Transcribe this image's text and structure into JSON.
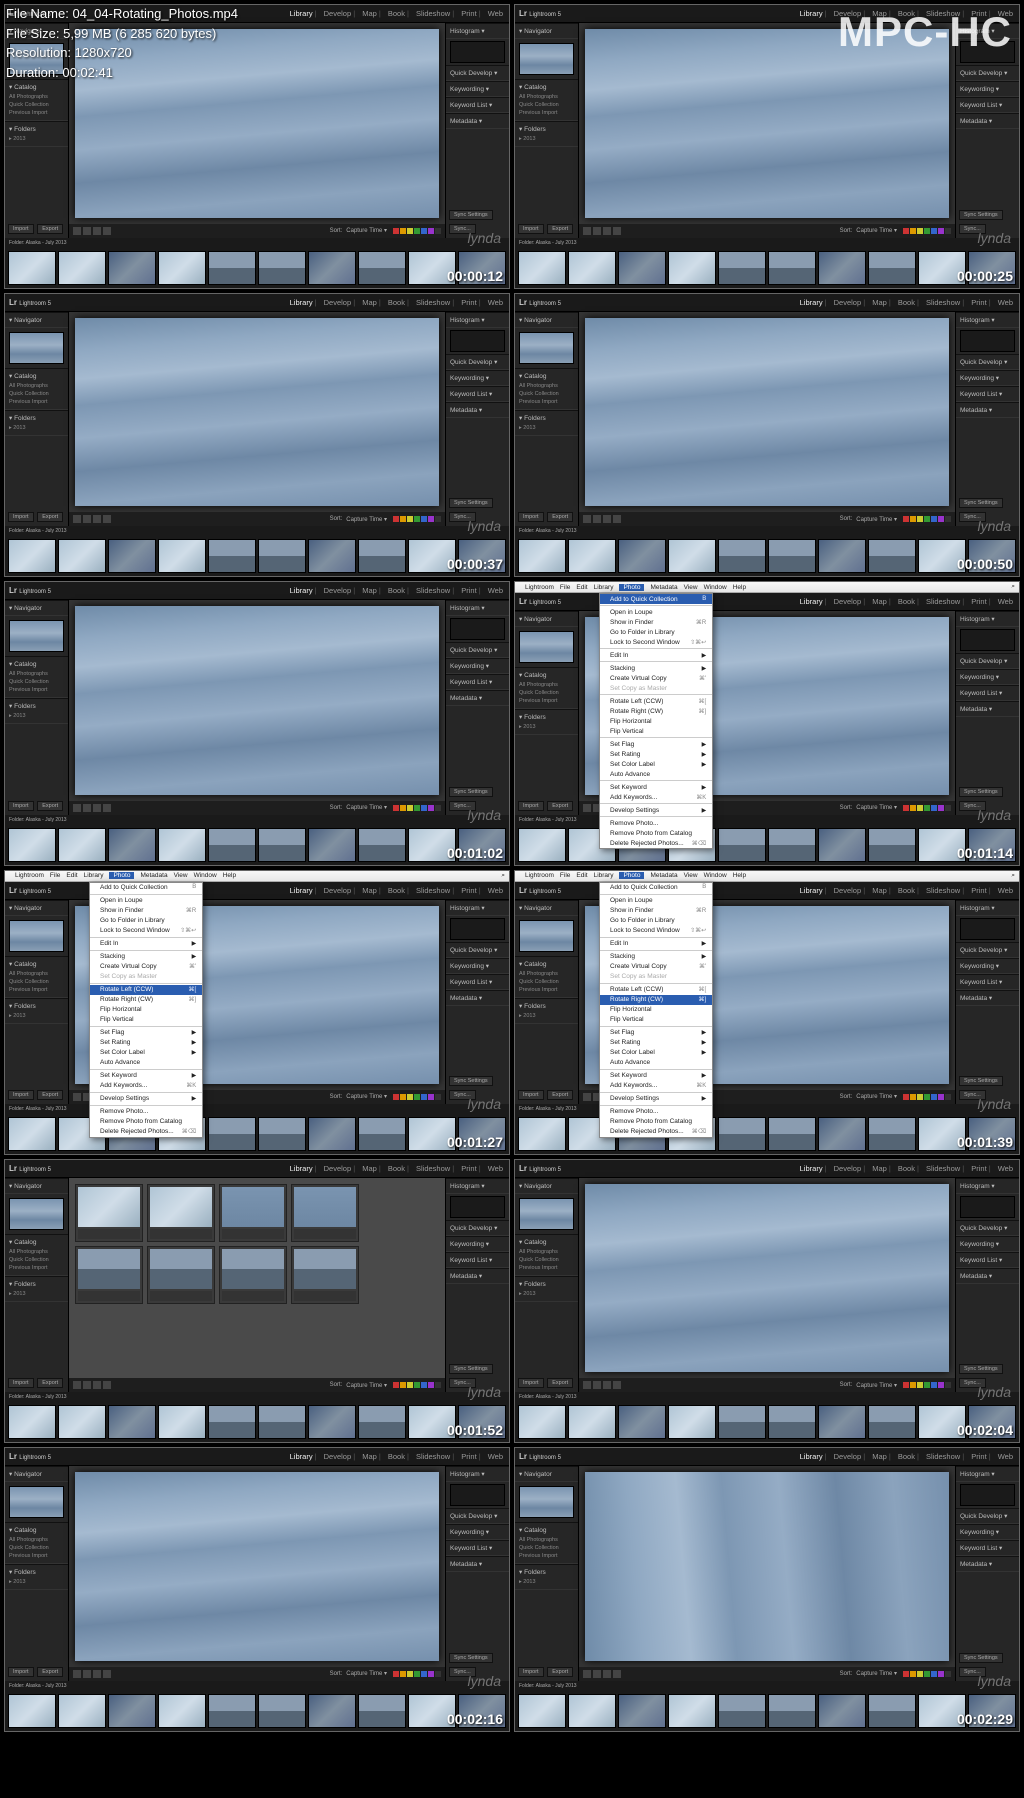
{
  "player": {
    "brand": "MPC-HC",
    "info": {
      "filename_label": "File Name:",
      "filename": "04_04-Rotating_Photos.mp4",
      "filesize_label": "File Size:",
      "filesize": "5,99 MB (6 285 620 bytes)",
      "resolution_label": "Resolution:",
      "resolution": "1280x720",
      "duration_label": "Duration:",
      "duration": "00:02:41"
    }
  },
  "watermark": "lynda",
  "lr": {
    "brand": "Lightroom 5",
    "logo_prefix": "Lr",
    "modules": [
      "Library",
      "Develop",
      "Map",
      "Book",
      "Slideshow",
      "Print",
      "Web"
    ],
    "active_module": "Library",
    "left_panels": {
      "navigator": "Navigator",
      "catalog": "Catalog",
      "catalog_items": [
        "All Photographs",
        "Quick Collection",
        "Previous Import"
      ],
      "folders": "Folders",
      "folder_item": "2013",
      "import_btn": "Import",
      "export_btn": "Export"
    },
    "right_panels": {
      "histogram": "Histogram",
      "quick_develop": "Quick Develop",
      "keywording": "Keywording",
      "keyword_list": "Keyword List",
      "metadata": "Metadata",
      "sync_btn": "Sync Settings",
      "sync_meta_btn": "Sync..."
    },
    "toolbar": {
      "sort_label": "Sort:",
      "sort_value": "Capture Time"
    },
    "filmstrip_path": "Folder: Alaska - July 2013",
    "color_labels": [
      "#c33",
      "#d90",
      "#cc3",
      "#393",
      "#36c",
      "#93c",
      "#333"
    ]
  },
  "mac_menu": {
    "items": [
      "Lightroom",
      "File",
      "Edit",
      "Library",
      "Photo",
      "Metadata",
      "View",
      "Window",
      "Help"
    ],
    "highlighted": "Photo",
    "search_icon": "⌕"
  },
  "photo_menu": {
    "items": [
      {
        "t": "Add to Quick Collection",
        "sc": "B"
      },
      {
        "sep": true
      },
      {
        "t": "Open in Loupe"
      },
      {
        "t": "Show in Finder",
        "sc": "⌘R"
      },
      {
        "t": "Go to Folder in Library"
      },
      {
        "t": "Lock to Second Window",
        "sc": "⇧⌘↩"
      },
      {
        "sep": true
      },
      {
        "t": "Edit In",
        "arrow": true
      },
      {
        "sep": true
      },
      {
        "t": "Stacking",
        "arrow": true
      },
      {
        "t": "Create Virtual Copy",
        "sc": "⌘'"
      },
      {
        "t": "Set Copy as Master",
        "dim": true
      },
      {
        "sep": true
      },
      {
        "t": "Rotate Left (CCW)",
        "sc": "⌘["
      },
      {
        "t": "Rotate Right (CW)",
        "sc": "⌘]"
      },
      {
        "t": "Flip Horizontal"
      },
      {
        "t": "Flip Vertical"
      },
      {
        "sep": true
      },
      {
        "t": "Set Flag",
        "arrow": true
      },
      {
        "t": "Set Rating",
        "arrow": true
      },
      {
        "t": "Set Color Label",
        "arrow": true
      },
      {
        "t": "Auto Advance"
      },
      {
        "sep": true
      },
      {
        "t": "Set Keyword",
        "arrow": true
      },
      {
        "t": "Add Keywords...",
        "sc": "⌘K"
      },
      {
        "sep": true
      },
      {
        "t": "Develop Settings",
        "arrow": true
      },
      {
        "sep": true
      },
      {
        "t": "Remove Photo..."
      },
      {
        "t": "Remove Photo from Catalog"
      },
      {
        "t": "Delete Rejected Photos...",
        "sc": "⌘⌫"
      }
    ]
  },
  "cells": [
    {
      "ts": "00:00:12",
      "variant": "loupe"
    },
    {
      "ts": "00:00:25",
      "variant": "loupe"
    },
    {
      "ts": "00:00:37",
      "variant": "loupe"
    },
    {
      "ts": "00:00:50",
      "variant": "loupe"
    },
    {
      "ts": "00:01:02",
      "variant": "loupe"
    },
    {
      "ts": "00:01:14",
      "variant": "menu",
      "hl": "Add to Quick Collection"
    },
    {
      "ts": "00:01:27",
      "variant": "menu",
      "hl": "Rotate Left (CCW)"
    },
    {
      "ts": "00:01:39",
      "variant": "menu",
      "hl": "Rotate Right (CW)"
    },
    {
      "ts": "00:01:52",
      "variant": "grid"
    },
    {
      "ts": "00:02:04",
      "variant": "loupe"
    },
    {
      "ts": "00:02:16",
      "variant": "loupe"
    },
    {
      "ts": "00:02:29",
      "variant": "loupe",
      "rot": true
    }
  ]
}
